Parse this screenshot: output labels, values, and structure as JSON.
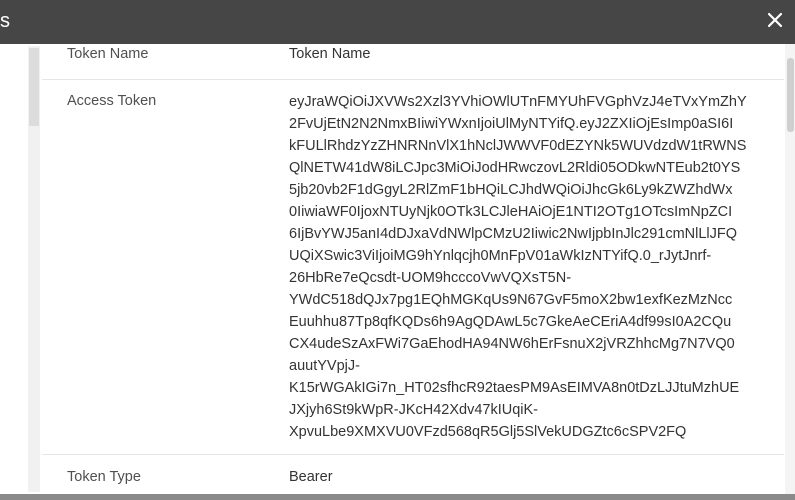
{
  "dialog": {
    "title_fragment": "s",
    "close_symbol": "✕"
  },
  "details": {
    "token_name": {
      "label": "Token Name",
      "value": "Token Name"
    },
    "access_token": {
      "label": "Access Token",
      "value": "eyJraWQiOiJXVWs2Xzl3YVhiOWlUTnFMYUhFVGphVzJ4eTVxYmZhY2FvUjEtN2N2NmxBIiwiYWxnIjoiUlMyNTYifQ.eyJ2ZXIiOjEsImp0aSI6IkFULlRhdzYzZHNRNnVlX1hNclJWWVF0dEZYNk5WUVdzdW1tRWNSQlNETW41dW8iLCJpc3MiOiJodHRwczovL2Rldi05ODkwNTEub2t0YS5jb20vb2F1dGgyL2RlZmF1bHQiLCJhdWQiOiJhcGk6Ly9kZWZhdWx0IiwiaWF0IjoxNTUyNjk0OTk3LCJleHAiOjE1NTI2OTg1OTcsImNpZCI6IjBvYWJ5anI4dDJxaVdNWlpCMzU2Iiwic2NwIjpbInJlc291cmNlLlJFQUQiXSwic3ViIjoiMG9hYnlqcjh0MnFpV01aWkIzNTYifQ.0_rJytJnrf-26HbRe7eQcsdt-UOM9hcccoVwVQXsT5N-YWdC518dQJx7pg1EQhMGKqUs9N67GvF5moX2bw1exfKezMzNccEuuhhu87Tp8qfKQDs6h9AgQDAwL5c7GkeAeCEriA4df99sI0A2CQuCX4udeSzAxFWi7GaEhodHA94NW6hErFsnuX2jVRZhhcMg7N7VQ0auutYVpjJ-K15rWGAkIGi7n_HT02sfhcR92taesPM9AsEIMVA8n0tDzLJJtuMzhUEJXjyh6St9kWpR-JKcH42Xdv47kIUqiK-XpvuLbe9XMXVU0VFzd568qR5Glj5SlVekUDGZtc6cSPV2FQ",
      "lines": [
        "eyJraWQiOiJXVWs2Xzl3YVhiOWlUTnFMYUhFVGphVzJ4eTVxYmZhY",
        "2FvUjEtN2N2NmxBIiwiYWxnIjoiUlMyNTYifQ.eyJ2ZXIiOjEsImp0aSI6I",
        "kFULlRhdzYzZHNRNnVlX1hNclJWWVF0dEZYNk5WUVdzdW1tRWNS",
        "QlNETW41dW8iLCJpc3MiOiJodHRwczovL2Rldi05ODkwNTEub2t0YS",
        "5jb20vb2F1dGgyL2RlZmF1bHQiLCJhdWQiOiJhcGk6Ly9kZWZhdWx",
        "0IiwiaWF0IjoxNTUyNjk0OTk3LCJleHAiOjE1NTI2OTg1OTcsImNpZCI",
        "6IjBvYWJ5anI4dDJxaVdNWlpCMzU2Iiwic2NwIjpbInJlc291cmNlLlJFQ",
        "UQiXSwic3ViIjoiMG9hYnlqcjh0MnFpV01aWkIzNTYifQ.0_rJytJnrf-",
        "26HbRe7eQcsdt-UOM9hcccoVwVQXsT5N-",
        "YWdC518dQJx7pg1EQhMGKqUs9N67GvF5moX2bw1exfKezMzNcc",
        "Euuhhu87Tp8qfKQDs6h9AgQDAwL5c7GkeAeCEriA4df99sI0A2CQu",
        "CX4udeSzAxFWi7GaEhodHA94NW6hErFsnuX2jVRZhhcMg7N7VQ0",
        "auutYVpjJ-",
        "K15rWGAkIGi7n_HT02sfhcR92taesPM9AsEIMVA8n0tDzLJJtuMzhUE",
        "JXjyh6St9kWpR-JKcH42Xdv47kIUqiK-",
        "XpvuLbe9XMXVU0VFzd568qR5Glj5SlVekUDGZtc6cSPV2FQ"
      ]
    },
    "token_type": {
      "label": "Token Type",
      "value": "Bearer"
    }
  },
  "colors": {
    "titlebar": "#464646",
    "label_text": "#505050",
    "value_text": "#333333",
    "row_divider": "#e6e6e6"
  },
  "icons": {
    "close": "close-icon"
  }
}
